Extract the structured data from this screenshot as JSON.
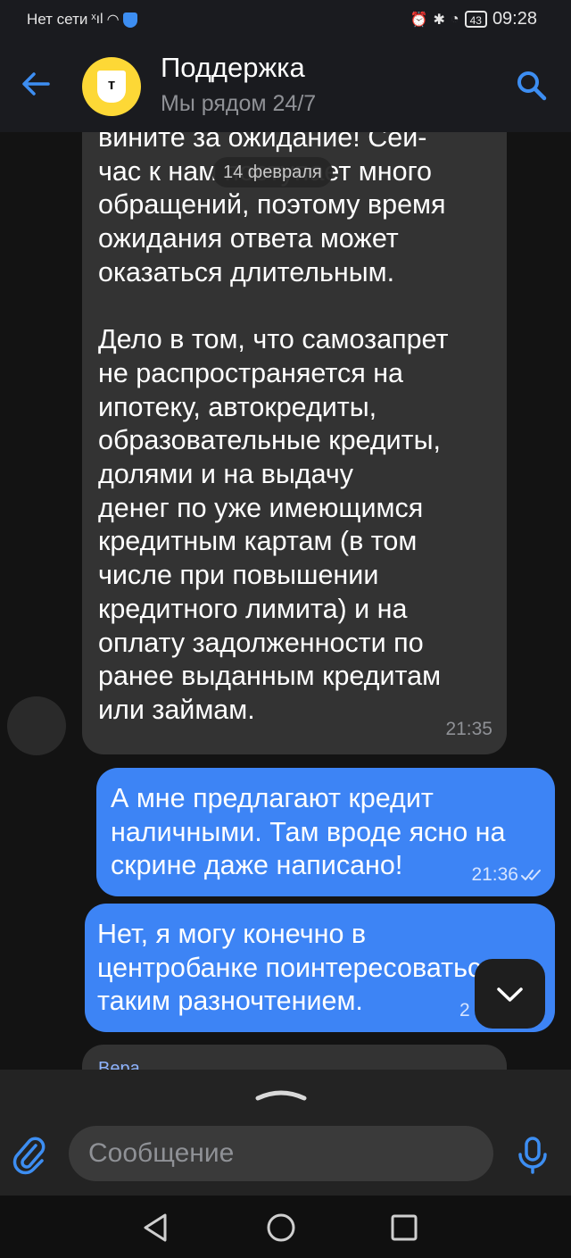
{
  "status_bar": {
    "carrier": "Нет сети",
    "battery": "43",
    "time": "09:28"
  },
  "header": {
    "title": "Поддержка",
    "subtitle": "Мы рядом 24/7",
    "avatar_letter": "т",
    "brand_color": "#fdd836"
  },
  "chat": {
    "date_chip": "14 февраля",
    "incoming_message": {
      "text": "вините за ожидание! Сей-\nчас к нам поступает много\nобращений, поэтому время\nожидания ответа может\nоказаться длительным.\n\nДело в том, что самозапрет\nне распространяется на\nипотеку, автокредиты,\nобразовательные кредиты,\nдолями и на выдачу\nденег по уже имеющимся\nкредитным картам (в том\nчисле при повышении\nкредитного лимита) и на\nоплату задолженности по\nранее выданным кредитам\nили займам.",
      "time": "21:35"
    },
    "outgoing_message_1": {
      "text": "А мне предлагают кредит\nналичными. Там вроде ясно на\nскрине даже написано!",
      "time": "21:36"
    },
    "outgoing_message_2": {
      "text": "Нет, я могу конечно в\nцентробанке поинтересоваться\nтаким разночтением.",
      "time": "2"
    },
    "next_message_sender": "Вера"
  },
  "composer": {
    "placeholder": "Сообщение"
  },
  "colors": {
    "accent": "#3d84f5",
    "incoming_bubble": "#333333",
    "background": "#131313"
  }
}
